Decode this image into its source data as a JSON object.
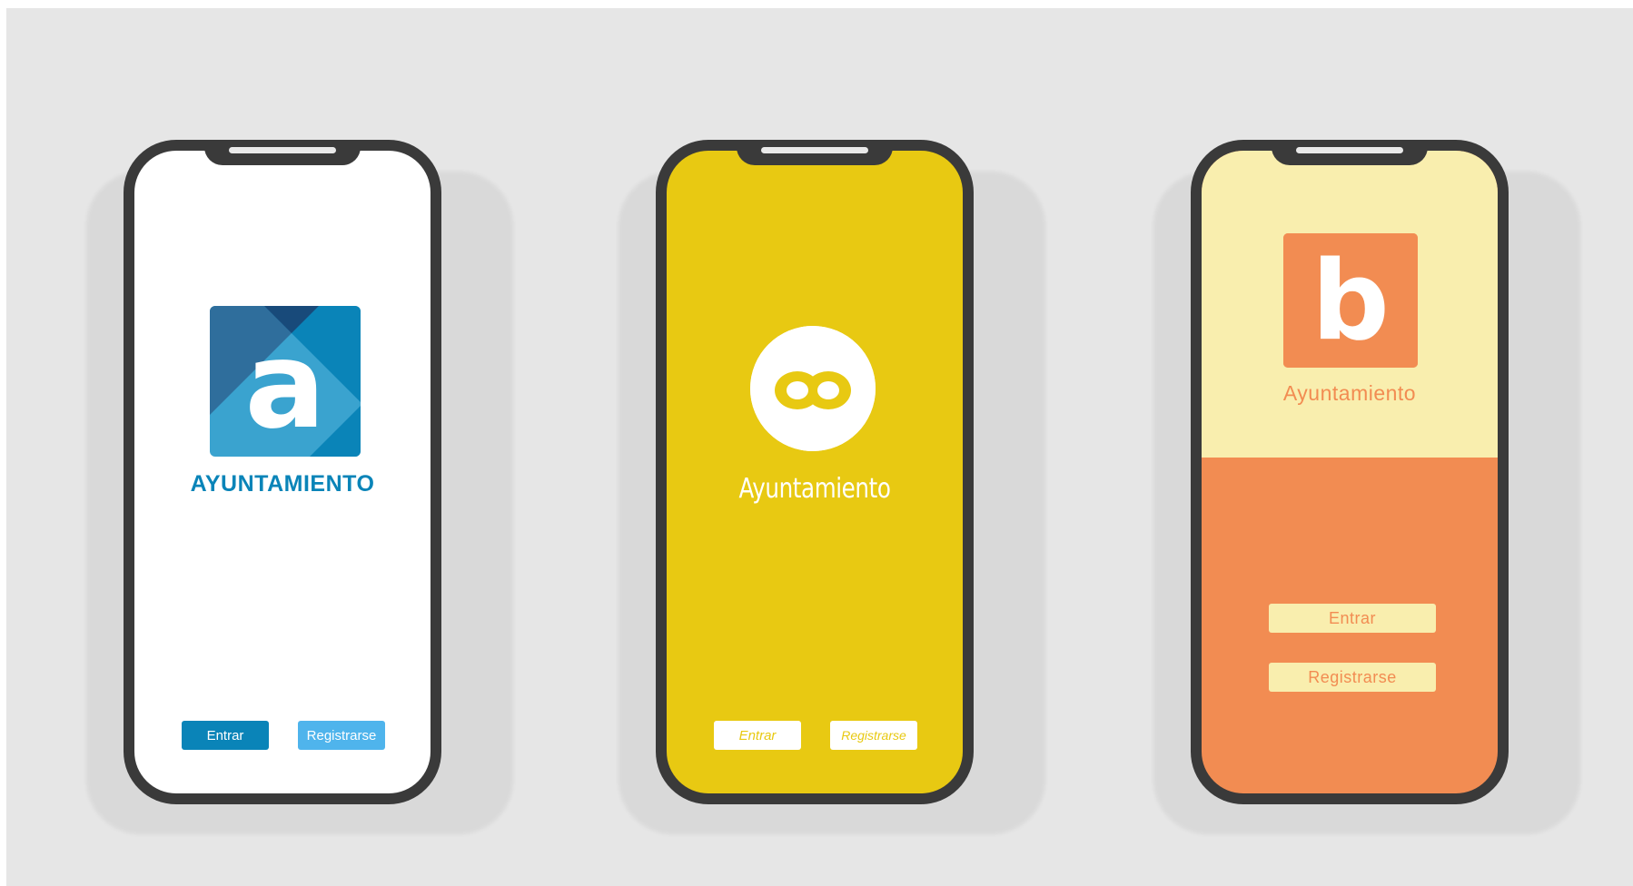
{
  "colors": {
    "background": "#e6e6e6",
    "phone_frame": "#3a3a3a",
    "blue_primary": "#0a84b8",
    "blue_light": "#4fb4ec",
    "yellow": "#e8c912",
    "cream": "#f9eeae",
    "orange": "#f28c52"
  },
  "phones": [
    {
      "variant": "blue",
      "logo_letter": "a",
      "title": "AYUNTAMIENTO",
      "enter_label": "Entrar",
      "register_label": "Registrarse"
    },
    {
      "variant": "yellow",
      "logo_letter": "ao",
      "title": "Ayuntamiento",
      "enter_label": "Entrar",
      "register_label": "Registrarse"
    },
    {
      "variant": "orange",
      "logo_letter": "b",
      "title": "Ayuntamiento",
      "enter_label": "Entrar",
      "register_label": "Registrarse"
    }
  ]
}
